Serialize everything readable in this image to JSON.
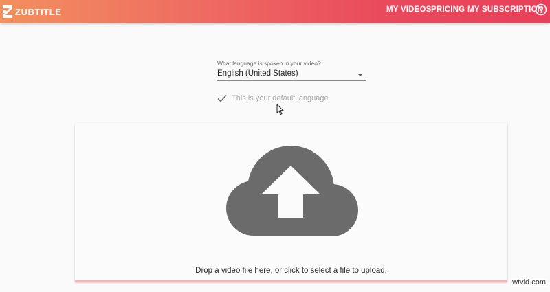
{
  "header": {
    "brand": "ZUBTITLE",
    "nav": [
      "MY VIDEOS",
      "PRICING",
      "MY SUBSCRIPTION"
    ],
    "help_icon": "help-circle-icon"
  },
  "language": {
    "label": "What language is spoken in your video?",
    "selected": "English (United States)",
    "default_note": "This is your default language"
  },
  "dropzone": {
    "text": "Drop a video file here, or click to select a file to upload.",
    "icon": "cloud-upload-icon"
  },
  "watermark": "wtvid.com",
  "colors": {
    "header_start": "#f2905e",
    "header_end": "#e8405a",
    "icon_gray": "#6b6b6b"
  }
}
